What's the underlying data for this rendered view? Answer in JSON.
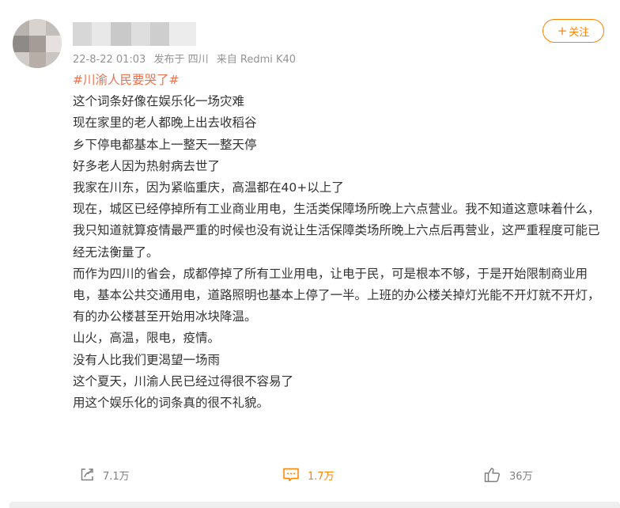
{
  "post": {
    "author": {
      "avatar_icon": "blurred-avatar",
      "username_obscured": true
    },
    "meta": {
      "time": "22-8-22 01:03",
      "location": "发布于 四川",
      "device": "来自 Redmi K40"
    },
    "follow_button": {
      "icon": "plus-icon",
      "label": "关注"
    },
    "hashtag": "#川渝人民要哭了#",
    "paragraphs": [
      "这个词条好像在娱乐化一场灾难",
      "现在家里的老人都晚上出去收稻谷",
      "乡下停电都基本上一整天一整天停",
      "好多老人因为热射病去世了",
      "我家在川东，因为紧临重庆，高温都在40+以上了",
      "现在，城区已经停掉所有工业商业用电，生活类保障场所晚上六点营业。我不知道这意味着什么，我只知道就算疫情最严重的时候也没有说让生活保障类场所晚上六点后再营业，这严重程度可能已经无法衡量了。",
      "而作为四川的省会，成都停掉了所有工业用电，让电于民，可是根本不够，于是开始限制商业用电，基本公共交通用电，道路照明也基本上停了一半。上班的办公楼关掉灯光能不开灯就不开灯，有的办公楼甚至开始用冰块降温。",
      "山火，高温，限电，疫情。",
      "没有人比我们更渴望一场雨",
      "这个夏天，川渝人民已经过得很不容易了",
      "用这个娱乐化的词条真的很不礼貌。"
    ],
    "actions": {
      "repost": {
        "icon": "share-icon",
        "count": "7.1万"
      },
      "comment": {
        "icon": "comment-icon",
        "count": "1.7万"
      },
      "like": {
        "icon": "thumbs-up-icon",
        "count": "36万"
      }
    },
    "colors": {
      "accent": "#ff8200",
      "hashtag": "#eb7350",
      "meta_text": "#939393",
      "body_text": "#333333"
    }
  }
}
